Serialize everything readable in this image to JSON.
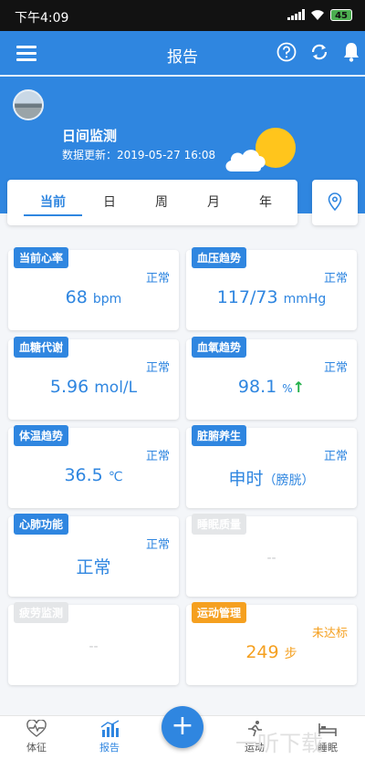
{
  "status_bar": {
    "time": "下午4:09",
    "battery": "45"
  },
  "header": {
    "title": "报告",
    "monitor_title": "日间监测",
    "update_label": "数据更新：",
    "update_time": "2019-05-27 16:08"
  },
  "tabs": [
    {
      "label": "当前",
      "active": true
    },
    {
      "label": "日"
    },
    {
      "label": "周"
    },
    {
      "label": "月"
    },
    {
      "label": "年"
    }
  ],
  "cards": {
    "heart_rate": {
      "tag": "当前心率",
      "status": "正常",
      "value": "68",
      "unit": "bpm"
    },
    "blood_pressure": {
      "tag": "血压趋势",
      "status": "正常",
      "value": "117/73",
      "unit": "mmHg"
    },
    "blood_sugar": {
      "tag": "血糖代谢",
      "status": "正常",
      "value": "5.96",
      "unit": "mol/L"
    },
    "blood_oxygen": {
      "tag": "血氧趋势",
      "status": "正常",
      "value": "98.1",
      "unit": "%",
      "trend": "↑"
    },
    "body_temp": {
      "tag": "体温趋势",
      "status": "正常",
      "value": "36.5",
      "unit": "℃"
    },
    "organ": {
      "tag": "脏腑养生",
      "status": "正常",
      "value": "申时",
      "unit": "（膀胱）"
    },
    "heart_lung": {
      "tag": "心肺功能",
      "status": "正常",
      "value": "正常"
    },
    "sleep_quality": {
      "tag": "睡眠质量",
      "value": "--"
    },
    "fatigue": {
      "tag": "疲劳监测",
      "value": "--"
    },
    "exercise": {
      "tag": "运动管理",
      "status": "未达标",
      "value": "249",
      "unit": "步"
    }
  },
  "bottom_nav": {
    "vitals": "体征",
    "report": "报告",
    "fab": "+",
    "sport": "运动",
    "sleep": "睡眠"
  },
  "watermark": "一听下载",
  "colors": {
    "primary": "#2f86e0",
    "warning": "#f5a020",
    "trend_up": "#22b04a",
    "inactive": "#e4e6e8"
  }
}
